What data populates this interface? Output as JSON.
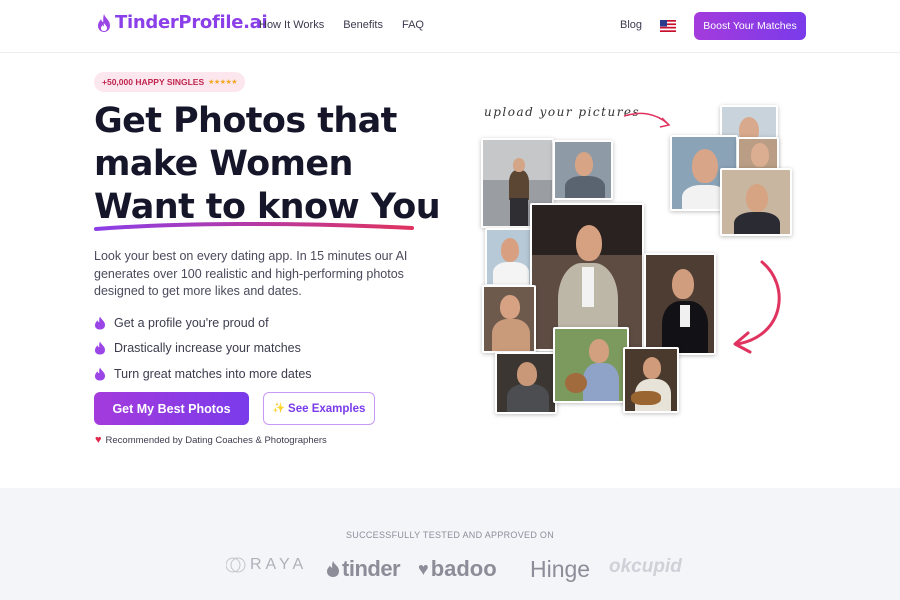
{
  "nav": {
    "logo": "TinderProfile.ai",
    "links": [
      "How It Works",
      "Benefits",
      "FAQ"
    ],
    "blog": "Blog",
    "cta": "Boost Your Matches"
  },
  "hero": {
    "badge": "+50,000 HAPPY SINGLES",
    "badge_stars": "★★★★★",
    "headline_line1": "Get Photos that",
    "headline_line2": "make Women",
    "headline_line3": "Want to know You",
    "description": "Look your best on every dating app. In 15 minutes our AI generates over 100 realistic and high-performing photos designed to get more likes and dates.",
    "features": [
      "Get a profile you're proud of",
      "Drastically increase your matches",
      "Turn great matches into more dates"
    ],
    "primary_cta": "Get My Best Photos",
    "secondary_cta": "See Examples",
    "secondary_icon": "✨",
    "recommend": "Recommended by Dating Coaches & Photographers",
    "upload_note": "upload your pictures"
  },
  "trust": {
    "title": "SUCCESSFULLY TESTED AND APPROVED ON",
    "brands": [
      "RAYA",
      "tinder",
      "badoo",
      "Hinge",
      "okcupid"
    ]
  },
  "colors": {
    "accent": "#8b3fe8",
    "accent_pink": "#e0335f",
    "strip_bg": "#f4f5f8"
  }
}
